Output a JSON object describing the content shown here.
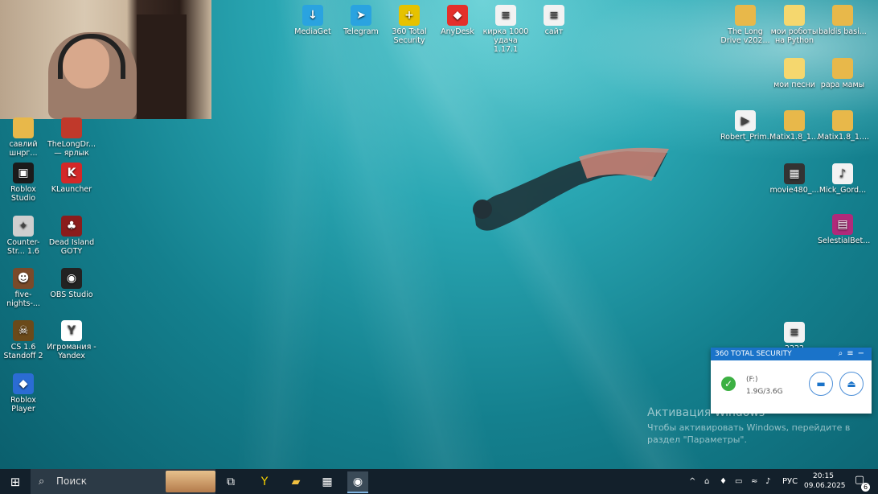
{
  "top_icons": [
    {
      "label": "MediaGet",
      "icon": "mediaget-icon",
      "color": "#2aa3e0",
      "glyph": "↓"
    },
    {
      "label": "Telegram",
      "icon": "telegram-icon",
      "color": "#2aa3e0",
      "glyph": "➤"
    },
    {
      "label": "360 Total Security",
      "icon": "360-security-icon",
      "color": "#e6c200",
      "glyph": "+"
    },
    {
      "label": "AnyDesk",
      "icon": "anydesk-icon",
      "color": "#e4302b",
      "glyph": "◆"
    },
    {
      "label": "кирка 1000 удача 1.17.1",
      "icon": "text-file-icon",
      "color": "#f2f2f2",
      "glyph": "≡"
    },
    {
      "label": "сайт",
      "icon": "text-file-icon",
      "color": "#f2f2f2",
      "glyph": "≡"
    }
  ],
  "left_icons": [
    {
      "label": "савлий шнрг...",
      "icon": "folder-icon",
      "color": "#e8b84a",
      "glyph": ""
    },
    {
      "label": "TheLongDr... — ярлык",
      "icon": "long-drive-icon",
      "color": "#c0392b",
      "glyph": ""
    },
    {
      "label": "Roblox Studio",
      "icon": "roblox-studio-icon",
      "color": "#1b1b1b",
      "glyph": "▣"
    },
    {
      "label": "KLauncher",
      "icon": "klauncher-icon",
      "color": "#d42828",
      "glyph": "K"
    },
    {
      "label": "Counter-Str... 1.6",
      "icon": "counter-strike-icon",
      "color": "#cfcfcf",
      "glyph": "✦"
    },
    {
      "label": "Dead Island GOTY",
      "icon": "dead-island-icon",
      "color": "#8a1c1c",
      "glyph": "♣"
    },
    {
      "label": "five-nights-...",
      "icon": "fnaf-icon",
      "color": "#7a4a2a",
      "glyph": "☻"
    },
    {
      "label": "OBS Studio",
      "icon": "obs-icon",
      "color": "#222",
      "glyph": "◉"
    },
    {
      "label": "CS 1.6 Standoff 2",
      "icon": "standoff-icon",
      "color": "#6b4a1a",
      "glyph": "☠"
    },
    {
      "label": "Игромания - Yandex",
      "icon": "yandex-icon",
      "color": "#fff",
      "glyph": "Y"
    },
    {
      "label": "Roblox Player",
      "icon": "roblox-player-icon",
      "color": "#2b6cd4",
      "glyph": "◆"
    }
  ],
  "right_icons": [
    {
      "label": "The Long Drive v202...",
      "icon": "long-drive-folder-icon",
      "color": "#e8b84a",
      "glyph": ""
    },
    {
      "label": "мои роботы на Python",
      "icon": "folder-icon",
      "color": "#f5d76e",
      "glyph": ""
    },
    {
      "label": "baldis basi...",
      "icon": "folder-zip-icon",
      "color": "#e8b84a",
      "glyph": ""
    },
    {
      "label": "мои песни",
      "icon": "folder-icon",
      "color": "#f5d76e",
      "glyph": ""
    },
    {
      "label": "papa мамы",
      "icon": "folder-icon",
      "color": "#e8b84a",
      "glyph": ""
    },
    {
      "label": "Robert_Prim...",
      "icon": "video-file-icon",
      "color": "#f2f2f2",
      "glyph": "▶"
    },
    {
      "label": "Matix1.8_1....",
      "icon": "folder-zip-icon",
      "color": "#e8b84a",
      "glyph": ""
    },
    {
      "label": "Matix1.8_1....",
      "icon": "folder-zip-icon",
      "color": "#e8b84a",
      "glyph": ""
    },
    {
      "label": "movie480_...",
      "icon": "movie-file-icon",
      "color": "#333",
      "glyph": "▦"
    },
    {
      "label": "Mick_Gord...",
      "icon": "image-file-icon",
      "color": "#f2f2f2",
      "glyph": "♪"
    },
    {
      "label": "SelestialBet...",
      "icon": "winrar-icon",
      "color": "#b02a7a",
      "glyph": "▤"
    },
    {
      "label": "2222",
      "icon": "text-file-icon",
      "color": "#f2f2f2",
      "glyph": "≡"
    }
  ],
  "popup": {
    "title": "360 TOTAL SECURITY",
    "drive_name": "(F:)",
    "drive_size": "1.9G/3.6G"
  },
  "activation": {
    "title": "Активация Windows",
    "line1": "Чтобы активировать Windows, перейдите в",
    "line2": "раздел \"Параметры\"."
  },
  "taskbar": {
    "search_placeholder": "Поиск",
    "language": "РУС",
    "time": "20:15",
    "date": "09.06.2025",
    "notifications": "6"
  }
}
